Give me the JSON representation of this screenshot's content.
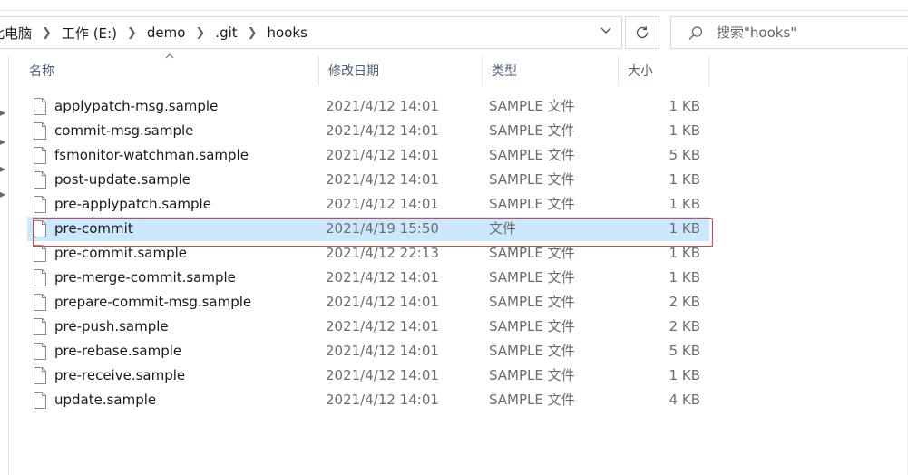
{
  "breadcrumb": {
    "items": [
      "此电脑",
      "工作 (E:)",
      "demo",
      ".git",
      "hooks"
    ]
  },
  "search": {
    "placeholder": "搜索\"hooks\""
  },
  "columns": {
    "name": "名称",
    "date": "修改日期",
    "type": "类型",
    "size": "大小"
  },
  "files": [
    {
      "name": "applypatch-msg.sample",
      "date": "2021/4/12 14:01",
      "type": "SAMPLE 文件",
      "size": "1 KB"
    },
    {
      "name": "commit-msg.sample",
      "date": "2021/4/12 14:01",
      "type": "SAMPLE 文件",
      "size": "1 KB"
    },
    {
      "name": "fsmonitor-watchman.sample",
      "date": "2021/4/12 14:01",
      "type": "SAMPLE 文件",
      "size": "5 KB"
    },
    {
      "name": "post-update.sample",
      "date": "2021/4/12 14:01",
      "type": "SAMPLE 文件",
      "size": "1 KB"
    },
    {
      "name": "pre-applypatch.sample",
      "date": "2021/4/12 14:01",
      "type": "SAMPLE 文件",
      "size": "1 KB"
    },
    {
      "name": "pre-commit",
      "date": "2021/4/19 15:50",
      "type": "文件",
      "size": "1 KB",
      "selected": true
    },
    {
      "name": "pre-commit.sample",
      "date": "2021/4/12 22:13",
      "type": "SAMPLE 文件",
      "size": "1 KB"
    },
    {
      "name": "pre-merge-commit.sample",
      "date": "2021/4/12 14:01",
      "type": "SAMPLE 文件",
      "size": "1 KB"
    },
    {
      "name": "prepare-commit-msg.sample",
      "date": "2021/4/12 14:01",
      "type": "SAMPLE 文件",
      "size": "2 KB"
    },
    {
      "name": "pre-push.sample",
      "date": "2021/4/12 14:01",
      "type": "SAMPLE 文件",
      "size": "2 KB"
    },
    {
      "name": "pre-rebase.sample",
      "date": "2021/4/12 14:01",
      "type": "SAMPLE 文件",
      "size": "5 KB"
    },
    {
      "name": "pre-receive.sample",
      "date": "2021/4/12 14:01",
      "type": "SAMPLE 文件",
      "size": "1 KB"
    },
    {
      "name": "update.sample",
      "date": "2021/4/12 14:01",
      "type": "SAMPLE 文件",
      "size": "4 KB"
    }
  ],
  "colors": {
    "selection": "#cce8ff",
    "highlight_border": "#d9454a",
    "header_text": "#4c607a"
  }
}
